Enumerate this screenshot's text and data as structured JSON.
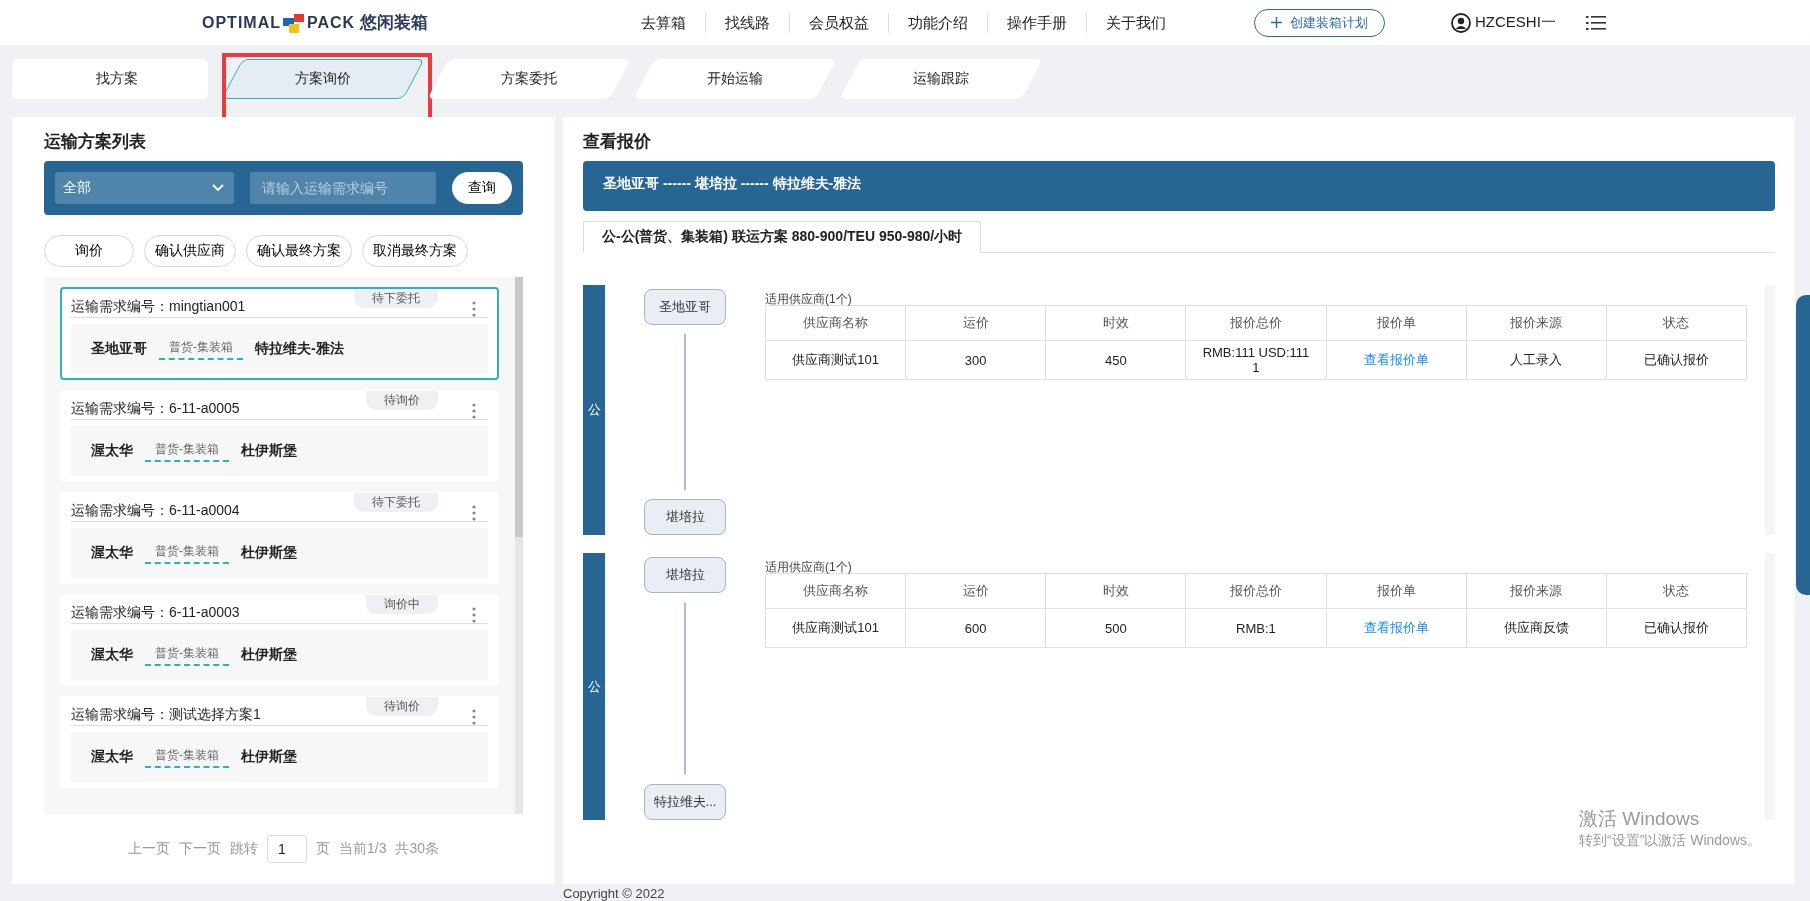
{
  "header": {
    "logo": {
      "word_a": "OPTIMAL",
      "word_b": "PACK",
      "name_cn": "悠闲装箱"
    },
    "nav": [
      "去算箱",
      "找线路",
      "会员权益",
      "功能介绍",
      "操作手册",
      "关于我们"
    ],
    "create_button": "创建装箱计划",
    "user": "HZCESHI一"
  },
  "steps": [
    {
      "label": "找方案",
      "selected": false
    },
    {
      "label": "方案询价",
      "selected": true
    },
    {
      "label": "方案委托",
      "selected": false
    },
    {
      "label": "开始运输",
      "selected": false
    },
    {
      "label": "运输跟踪",
      "selected": false
    }
  ],
  "left": {
    "title": "运输方案列表",
    "filter": "全部",
    "search": {
      "placeholder": "请输入运输需求编号"
    },
    "query_button": "查询",
    "actions": [
      "询价",
      "确认供应商",
      "确认最终方案",
      "取消最终方案"
    ],
    "cards": [
      {
        "id_label": "运输需求编号：",
        "id": "mingtian001",
        "status": "待下委托",
        "from": "圣地亚哥",
        "mode": "普货-集装箱",
        "to": "特拉维夫-雅法",
        "selected": true
      },
      {
        "id_label": "运输需求编号：",
        "id": "6-11-a0005",
        "status": "待询价",
        "from": "渥太华",
        "mode": "普货-集装箱",
        "to": "杜伊斯堡",
        "selected": false
      },
      {
        "id_label": "运输需求编号：",
        "id": "6-11-a0004",
        "status": "待下委托",
        "from": "渥太华",
        "mode": "普货-集装箱",
        "to": "杜伊斯堡",
        "selected": false
      },
      {
        "id_label": "运输需求编号：",
        "id": "6-11-a0003",
        "status": "询价中",
        "from": "渥太华",
        "mode": "普货-集装箱",
        "to": "杜伊斯堡",
        "selected": false
      },
      {
        "id_label": "运输需求编号：",
        "id": "测试选择方案1",
        "status": "待询价",
        "from": "渥太华",
        "mode": "普货-集装箱",
        "to": "杜伊斯堡",
        "selected": false
      }
    ],
    "pagination": {
      "prev": "上一页",
      "next": "下一页",
      "jump": "跳转",
      "page_value": "1",
      "page_unit": "页",
      "current": "当前1/3",
      "total": "共30条"
    }
  },
  "right": {
    "title": "查看报价",
    "route": "圣地亚哥 ------ 堪培拉 ------ 特拉维夫-雅法",
    "plan_tab": {
      "label": "公-公(普货、集装箱) 联运方案 880-900/TEU 950-980/小时",
      "selected": true
    },
    "segments": [
      {
        "mode": "公",
        "from": "圣地亚哥",
        "to": "堪培拉",
        "caption": "适用供应商(1个)",
        "columns": [
          "供应商名称",
          "运价",
          "时效",
          "报价总价",
          "报价单",
          "报价来源",
          "状态"
        ],
        "rows": [
          {
            "name": "供应商测试101",
            "freight": "300",
            "time": "450",
            "total": "RMB:111 USD:1111",
            "link": "查看报价单",
            "source": "人工录入",
            "status": "已确认报价"
          }
        ]
      },
      {
        "mode": "公",
        "from": "堪培拉",
        "to": "特拉维夫...",
        "caption": "适用供应商(1个)",
        "columns": [
          "供应商名称",
          "运价",
          "时效",
          "报价总价",
          "报价单",
          "报价来源",
          "状态"
        ],
        "rows": [
          {
            "name": "供应商测试101",
            "freight": "600",
            "time": "500",
            "total": "RMB:1",
            "link": "查看报价单",
            "source": "供应商反馈",
            "status": "已确认报价"
          }
        ]
      }
    ]
  },
  "os_watermark": {
    "title": "激活 Windows",
    "hint": "转到“设置”以激活 Windows。"
  },
  "footer": "Copyright © 2022"
}
